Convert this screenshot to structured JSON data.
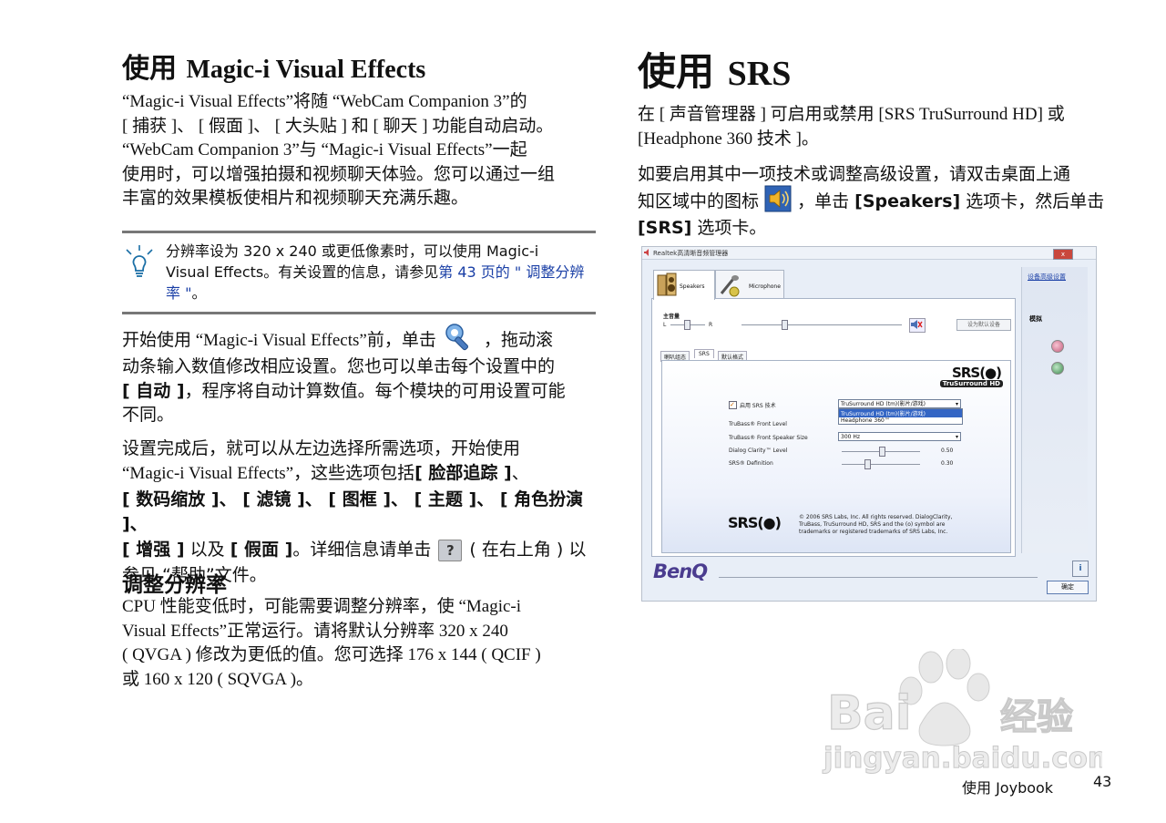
{
  "left": {
    "section1": {
      "title_prefix": "使用",
      "title_name": "Magic-i Visual Effects",
      "para": [
        "“Magic-i Visual Effects”将随 “WebCam Companion 3”的",
        "[ 捕获 ]、 [ 假面 ]、 [ 大头贴 ] 和 [ 聊天 ] 功能自动启动。",
        "“WebCam Companion 3”与 “Magic-i Visual Effects”一起",
        "使用时，可以增强拍摄和视频聊天体验。您可以通过一组",
        "丰富的效果模板使相片和视频聊天充满乐趣。"
      ]
    },
    "note": {
      "line1": "分辨率设为 320  x 240 或更低像素时，可以使用 Magic-i",
      "line2_a": "Visual Effects。有关设置的信息，请参见",
      "line2_link": "第 43 页的 \" 调整分辨",
      "line3_link": "率 \"",
      "line3_end": "。"
    },
    "para2": {
      "l1_a": "开始使用 “Magic-i Visual Effects”前，单击",
      "l1_b": "，拖动滚",
      "l2": "动条输入数值修改相应设置。您也可以单击每个设置中的",
      "l3_bold": "[ 自动 ]",
      "l3_rest": "，程序将自动计算数值。每个模块的可用设置可能",
      "l4": "不同。"
    },
    "para3": {
      "l1": "设置完成后，就可以从左边选择所需选项，开始使用",
      "l2_a": "“Magic-i Visual Effects”，这些选项包括",
      "l2_b": "[ 脸部追踪 ]",
      "l2_c": "、",
      "l3": "[ 数码缩放 ]、 [ 滤镜 ]、 [ 图框 ]、 [ 主题 ]、 [ 角色扮演 ]、",
      "l4_a": "[ 增强 ]",
      "l4_b": " 以及 ",
      "l4_c": "[ 假面 ]",
      "l4_d": "。详细信息请单击",
      "l4_e": "( 在右上角 ) 以",
      "l5": "参见 “帮助”文件。"
    },
    "section2": {
      "title": "调整分辨率",
      "para": [
        "CPU 性能变低时，可能需要调整分辨率，使 “Magic-i",
        "Visual Effects”正常运行。请将默认分辨率 320 x 240",
        "( QVGA ) 修改为更低的值。您可选择 176 x 144 ( QCIF )",
        "或 160 x 120 ( SQVGA )。"
      ]
    }
  },
  "right": {
    "title_prefix": "使用",
    "title_name": "SRS",
    "p1": [
      "在 [ 声音管理器 ] 可启用或禁用 [SRS TruSurround HD] 或",
      "[Headphone 360 技术 ]。"
    ],
    "p2_l1": "如要启用其中一项技术或调整高级设置，请双击桌面上通",
    "p2_l2_a": "知区域中的图标",
    "p2_l2_b": "，单击 ",
    "p2_l2_c": "[Speakers]",
    "p2_l2_d": " 选项卡，然后单击",
    "p2_l3_a": "[SRS]",
    "p2_l3_b": " 选项卡。"
  },
  "dialog": {
    "title": "Realtek高清晰音频管理器",
    "win_buttons": [
      "_",
      "□",
      "x"
    ],
    "tabs": [
      "Speakers",
      "Microphone"
    ],
    "main_volume": "主音量",
    "left": "L",
    "right": "R",
    "set_default": "设为默认设备",
    "subtabs": [
      "喇叭组态",
      "SRS",
      "默认格式"
    ],
    "srs_logo": "SRS(●)",
    "trusurround": "TruSurround HD",
    "enable_srs": "启用 SRS 技术",
    "dropdown_value": "TruSurround HD (tm)(影片/游戏)",
    "dropdown_options": [
      "TruSurround HD (tm)(影片/游戏)",
      "Headphone 360™"
    ],
    "rows": [
      {
        "label": "TruBass® Front Level",
        "value": ""
      },
      {
        "label": "TruBass® Front Speaker Size",
        "value": "300 Hz"
      },
      {
        "label": "Dialog Clarity™ Level",
        "value": "0.50"
      },
      {
        "label": "SRS® Definition",
        "value": "0.30"
      }
    ],
    "copyright": [
      "© 2006 SRS Labs, Inc. All rights reserved. DialogClarity,",
      "TruBass, TruSurround HD, SRS and the (o) symbol are",
      "trademarks or registered trademarks of SRS Labs, Inc."
    ],
    "advanced_link": "设备高级设置",
    "analog": "模拟",
    "brand": "BenQ",
    "ok": "确定",
    "info_button": "i"
  },
  "footer": {
    "label": "使用 Joybook",
    "page": "43"
  },
  "colors": {
    "link": "#1a3fa6",
    "rule": "#777777",
    "benq": "#4a3c8f"
  }
}
